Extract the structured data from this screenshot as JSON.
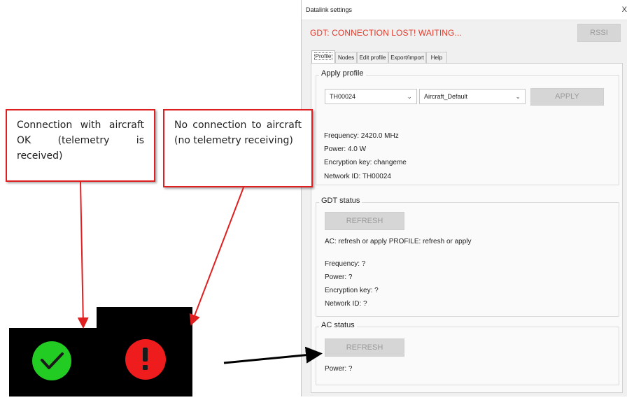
{
  "window": {
    "title": "Datalink settings",
    "close_glyph": "X",
    "connection_status": "GDT: CONNECTION LOST! WAITING...",
    "rssi_label": "RSSI"
  },
  "tabs": [
    {
      "label": "Profile",
      "active": true
    },
    {
      "label": "Nodes"
    },
    {
      "label": "Edit profile"
    },
    {
      "label": "Export/import"
    },
    {
      "label": "Help"
    }
  ],
  "apply_profile": {
    "group_label": "Apply profile",
    "profile_select_value": "TH00024",
    "config_select_value": "Aircraft_Default",
    "apply_label": "APPLY",
    "frequency": "Frequency: 2420.0 MHz",
    "power": "Power: 4.0 W",
    "encryption": "Encryption key: changeme",
    "network_id": "Network ID: TH00024"
  },
  "gdt_status": {
    "group_label": "GDT status",
    "refresh_label": "REFRESH",
    "message": "AC: refresh or apply PROFILE: refresh or apply",
    "frequency": "Frequency: ?",
    "power": "Power: ?",
    "encryption": "Encryption key: ?",
    "network_id": "Network ID: ?"
  },
  "ac_status": {
    "group_label": "AC status",
    "refresh_label": "REFRESH",
    "power": "Power: ?"
  },
  "callouts": {
    "ok": "Connection with aircraft OK (telemetry is received)",
    "lost": "No connection to aircraft (no telemetry receiving)"
  },
  "icons": {
    "ok": {
      "name": "check-icon",
      "color": "#22cc22"
    },
    "lost": {
      "name": "exclamation-icon",
      "color": "#ee1c1c",
      "glyph": "!"
    }
  },
  "colors": {
    "status_error": "#e03a2a",
    "callout_border": "#e02020",
    "arrow_red": "#e02020",
    "arrow_black": "#000000"
  }
}
